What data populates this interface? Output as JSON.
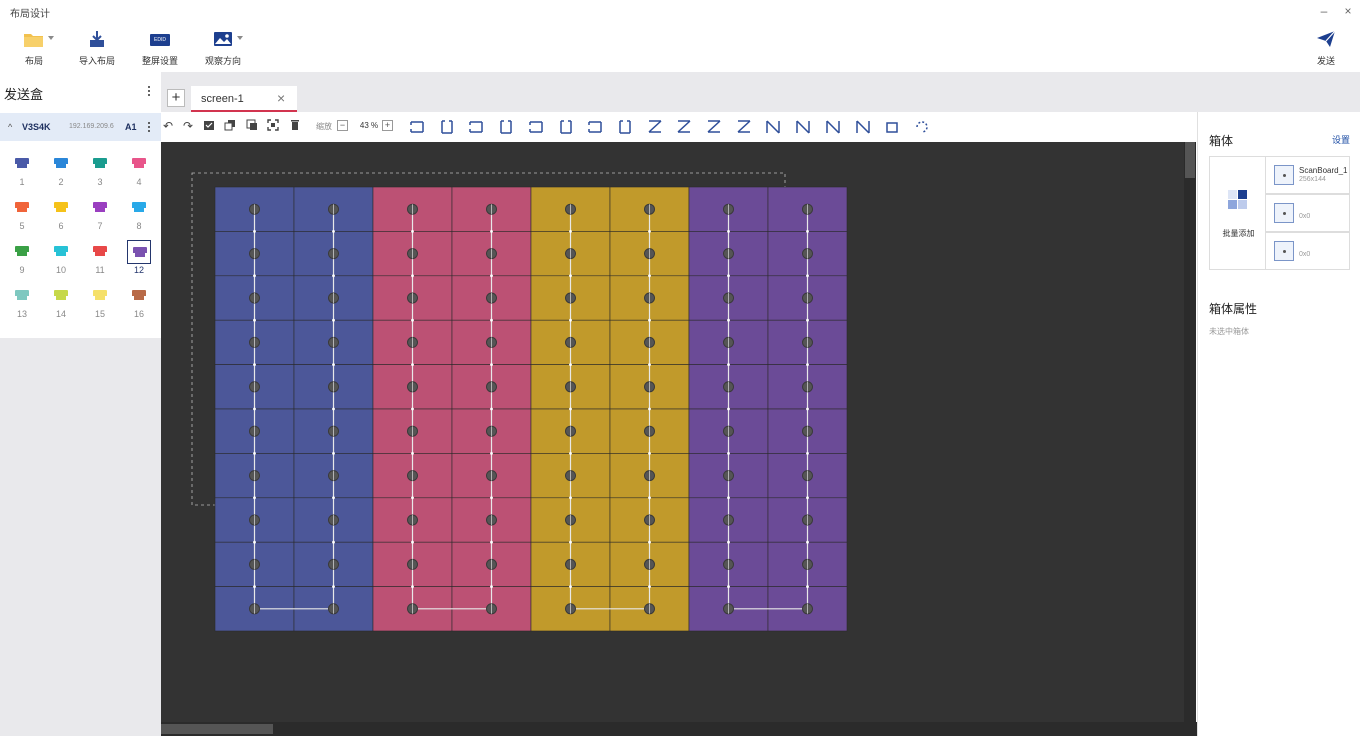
{
  "window": {
    "title": "布局设计",
    "minimize": "–",
    "close": "×"
  },
  "toolbar": {
    "layout_label": "布局",
    "import_label": "导入布局",
    "screen_settings_label": "整屏设置",
    "screen_settings_badge": "EDID",
    "view_direction_label": "观察方向",
    "send_label": "发送"
  },
  "sidebar": {
    "title": "发送盒",
    "device": {
      "name": "V3S4K",
      "ip": "192.169.209.6",
      "tag": "A1"
    },
    "ports": [
      {
        "num": "1",
        "color": "#4a5aa8"
      },
      {
        "num": "2",
        "color": "#2a86d8"
      },
      {
        "num": "3",
        "color": "#1a9c8f"
      },
      {
        "num": "4",
        "color": "#e8558a"
      },
      {
        "num": "5",
        "color": "#f0643a"
      },
      {
        "num": "6",
        "color": "#f5c21a"
      },
      {
        "num": "7",
        "color": "#9a3fc0"
      },
      {
        "num": "8",
        "color": "#29a9e8"
      },
      {
        "num": "9",
        "color": "#3aa046"
      },
      {
        "num": "10",
        "color": "#27c2d6"
      },
      {
        "num": "11",
        "color": "#e84848"
      },
      {
        "num": "12",
        "color": "#7a52b0"
      },
      {
        "num": "13",
        "color": "#7ec8c0"
      },
      {
        "num": "14",
        "color": "#c6d84a"
      },
      {
        "num": "15",
        "color": "#f5e06a"
      },
      {
        "num": "16",
        "color": "#b86a48"
      }
    ],
    "selected_port": "12"
  },
  "tabs": {
    "items": [
      {
        "label": "screen-1"
      }
    ]
  },
  "edit_toolbar": {
    "zoom_label": "缩放",
    "zoom_value": "43 %",
    "zoom_minus": "−",
    "zoom_plus": "+"
  },
  "canvas": {
    "background": "#333333",
    "column_colors": [
      "#4c5799",
      "#4c5799",
      "#bc5174",
      "#bc5174",
      "#c19a2b",
      "#c19a2b",
      "#6b4b97",
      "#6b4b97"
    ],
    "rows": 10,
    "columns": 8
  },
  "right_panel": {
    "title": "箱体",
    "settings_link": "设置",
    "batch_add_label": "批量添加",
    "cabinets": [
      {
        "name": "ScanBoard_1",
        "size": "256x144"
      },
      {
        "name": "",
        "size": "0x0"
      },
      {
        "name": "",
        "size": "0x0"
      }
    ],
    "properties_title": "箱体属性",
    "no_selection": "未选中箱体"
  },
  "accent_color": "#1f4fa6"
}
